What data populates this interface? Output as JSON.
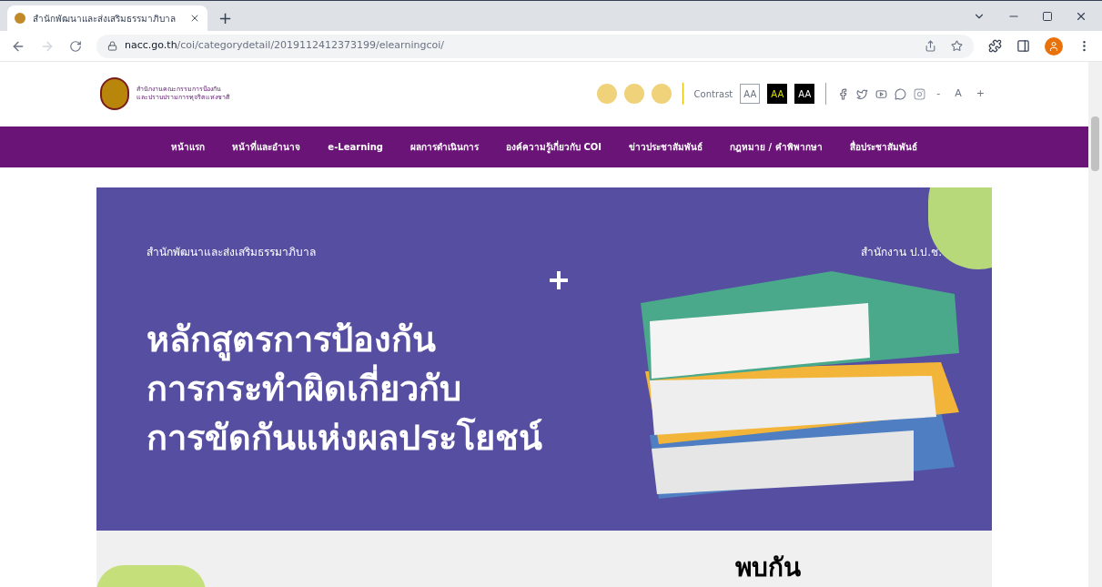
{
  "browser": {
    "tab_title": "สำนักพัฒนาและส่งเสริมธรรมาภิบาล",
    "new_tab": "+",
    "url_host": "nacc.go.th",
    "url_path": "/coi/categorydetail/2019112412373199/elearningcoi/"
  },
  "header": {
    "logo_lines": [
      "สำนักงานคณะกรรมการป้องกัน",
      "และปราบปรามการทุจริตแห่งชาติ"
    ],
    "contrast_label": "Contrast",
    "contrast_options": [
      {
        "label": "AA",
        "kind": "light"
      },
      {
        "label": "AA",
        "kind": "yellow"
      },
      {
        "label": "AA",
        "kind": "dark"
      }
    ],
    "font_sizes": [
      "-",
      "A",
      "+"
    ]
  },
  "nav": [
    "หน้าแรก",
    "หน้าที่และอำนาจ",
    "e-Learning",
    "ผลการดำเนินการ",
    "องค์ความรู้เกี่ยวกับ COI",
    "ข่าวประชาสัมพันธ์",
    "กฎหมาย / คำพิพากษา",
    "สื่อประชาสัมพันธ์"
  ],
  "banner": {
    "left_caption": "สำนักพัฒนาและส่งเสริมธรรมาภิบาล",
    "right_caption": "สำนักงาน ป.ป.ช.",
    "title_lines": [
      "หลักสูตรการป้องกัน",
      "การกระทำผิดเกี่ยวกับ",
      "การขัดกันแห่งผลประโยชน์"
    ]
  },
  "section": {
    "heading": "พบกัน"
  }
}
